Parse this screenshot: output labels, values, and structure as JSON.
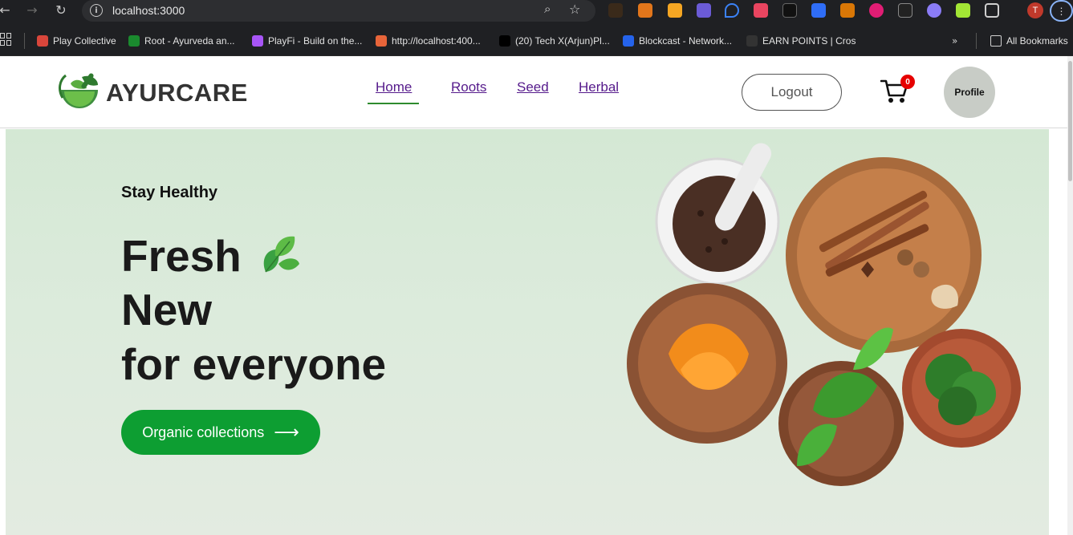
{
  "browser": {
    "url": "localhost:3000",
    "bookmarks": [
      {
        "label": "Play Collective",
        "color": "#d9463b"
      },
      {
        "label": "Root - Ayurveda an...",
        "color": "#1a8a2e"
      },
      {
        "label": "PlayFi - Build on the...",
        "color": "#a855f7"
      },
      {
        "label": "http://localhost:400...",
        "color": "#e8653a"
      },
      {
        "label": "(20) Tech X(Arjun)Pl...",
        "color": "#000000"
      },
      {
        "label": "Blockcast - Network...",
        "color": "#2563eb"
      },
      {
        "label": "EARN POINTS | Cros",
        "color": "#333333"
      }
    ],
    "all_bookmarks_label": "All Bookmarks",
    "profile_initial": "T"
  },
  "header": {
    "brand": "AYURCARE",
    "nav": [
      "Home",
      "Roots",
      "Seed",
      "Herbal"
    ],
    "logout_label": "Logout",
    "cart_count": "0",
    "profile_label": "Profile",
    "colors": {
      "accent": "#0d9e32",
      "link": "#551a8b"
    }
  },
  "hero": {
    "tagline": "Stay Healthy",
    "headline": [
      "Fresh",
      "New",
      "for everyone"
    ],
    "cta_label": "Organic collections",
    "cta_icon": "arrow-right-icon"
  }
}
